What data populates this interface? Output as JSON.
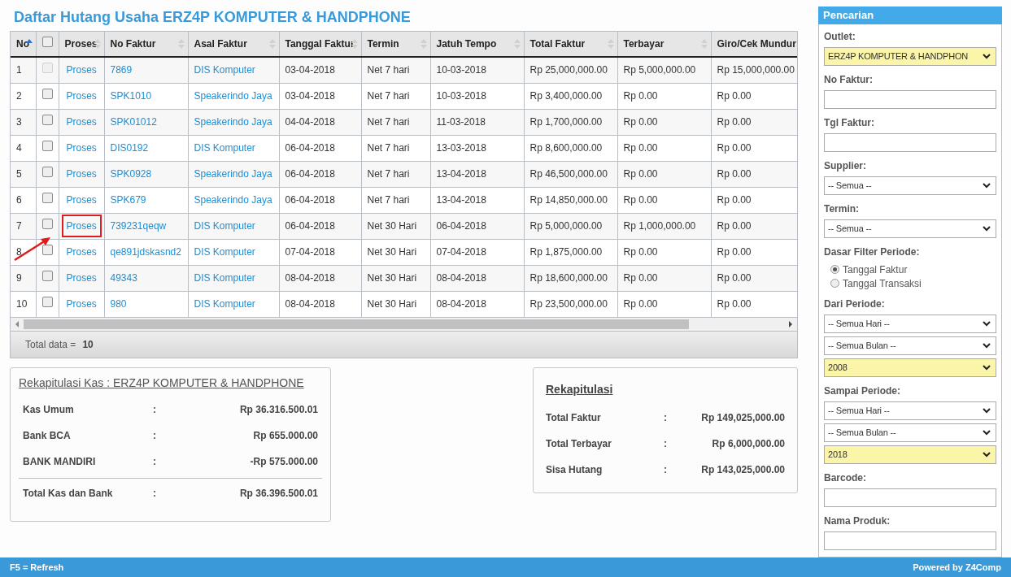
{
  "title": "Daftar Hutang Usaha ERZ4P KOMPUTER & HANDPHONE",
  "table": {
    "columns": [
      {
        "label": "No",
        "kind": "text",
        "sortable": true,
        "sorted": true
      },
      {
        "kind": "checkbox",
        "checked": false,
        "sortable": false
      },
      {
        "label": "Proses",
        "kind": "text",
        "sortable": true,
        "sorted": false
      },
      {
        "label": "No Faktur",
        "kind": "text",
        "sortable": true,
        "sorted": false
      },
      {
        "label": "Asal Faktur",
        "kind": "text",
        "sortable": true,
        "sorted": false
      },
      {
        "label": "Tanggal Faktur",
        "kind": "text",
        "sortable": true,
        "sorted": false
      },
      {
        "label": "Termin",
        "kind": "text",
        "sortable": true,
        "sorted": false
      },
      {
        "label": "Jatuh Tempo",
        "kind": "text",
        "sortable": true,
        "sorted": false
      },
      {
        "label": "Total Faktur",
        "kind": "text",
        "sortable": true,
        "sorted": false
      },
      {
        "label": "Terbayar",
        "kind": "text",
        "sortable": true,
        "sorted": false
      },
      {
        "label": "Giro/Cek Mundur",
        "kind": "text",
        "sortable": false
      }
    ],
    "rows": [
      {
        "no": "1",
        "checked": false,
        "disabled": true,
        "proses": "Proses",
        "highlighted": false,
        "no_faktur": "7869",
        "asal_faktur": "DIS Komputer",
        "tanggal_faktur": "03-04-2018",
        "termin": "Net 7 hari",
        "jatuh_tempo": "10-03-2018",
        "total_faktur": "Rp 25,000,000.00",
        "terbayar": "Rp 5,000,000.00",
        "giro": "Rp 15,000,000.00"
      },
      {
        "no": "2",
        "checked": false,
        "disabled": false,
        "proses": "Proses",
        "highlighted": false,
        "no_faktur": "SPK1010",
        "asal_faktur": "Speakerindo Jaya",
        "tanggal_faktur": "03-04-2018",
        "termin": "Net 7 hari",
        "jatuh_tempo": "10-03-2018",
        "total_faktur": "Rp 3,400,000.00",
        "terbayar": "Rp 0.00",
        "giro": "Rp 0.00"
      },
      {
        "no": "3",
        "checked": false,
        "disabled": false,
        "proses": "Proses",
        "highlighted": false,
        "no_faktur": "SPK01012",
        "asal_faktur": "Speakerindo Jaya",
        "tanggal_faktur": "04-04-2018",
        "termin": "Net 7 hari",
        "jatuh_tempo": "11-03-2018",
        "total_faktur": "Rp 1,700,000.00",
        "terbayar": "Rp 0.00",
        "giro": "Rp 0.00"
      },
      {
        "no": "4",
        "checked": false,
        "disabled": false,
        "proses": "Proses",
        "highlighted": false,
        "no_faktur": "DIS0192",
        "asal_faktur": "DIS Komputer",
        "tanggal_faktur": "06-04-2018",
        "termin": "Net 7 hari",
        "jatuh_tempo": "13-03-2018",
        "total_faktur": "Rp 8,600,000.00",
        "terbayar": "Rp 0.00",
        "giro": "Rp 0.00"
      },
      {
        "no": "5",
        "checked": false,
        "disabled": false,
        "proses": "Proses",
        "highlighted": false,
        "no_faktur": "SPK0928",
        "asal_faktur": "Speakerindo Jaya",
        "tanggal_faktur": "06-04-2018",
        "termin": "Net 7 hari",
        "jatuh_tempo": "13-04-2018",
        "total_faktur": "Rp 46,500,000.00",
        "terbayar": "Rp 0.00",
        "giro": "Rp 0.00"
      },
      {
        "no": "6",
        "checked": false,
        "disabled": false,
        "proses": "Proses",
        "highlighted": false,
        "no_faktur": "SPK679",
        "asal_faktur": "Speakerindo Jaya",
        "tanggal_faktur": "06-04-2018",
        "termin": "Net 7 hari",
        "jatuh_tempo": "13-04-2018",
        "total_faktur": "Rp 14,850,000.00",
        "terbayar": "Rp 0.00",
        "giro": "Rp 0.00"
      },
      {
        "no": "7",
        "checked": false,
        "disabled": false,
        "proses": "Proses",
        "highlighted": true,
        "no_faktur": "739231qeqw",
        "asal_faktur": "DIS Komputer",
        "tanggal_faktur": "06-04-2018",
        "termin": "Net 30 Hari",
        "jatuh_tempo": "06-04-2018",
        "total_faktur": "Rp 5,000,000.00",
        "terbayar": "Rp 1,000,000.00",
        "giro": "Rp 0.00"
      },
      {
        "no": "8",
        "checked": false,
        "disabled": false,
        "proses": "Proses",
        "highlighted": false,
        "no_faktur": "qe891jdskasnd2",
        "asal_faktur": "DIS Komputer",
        "tanggal_faktur": "07-04-2018",
        "termin": "Net 30 Hari",
        "jatuh_tempo": "07-04-2018",
        "total_faktur": "Rp 1,875,000.00",
        "terbayar": "Rp 0.00",
        "giro": "Rp 0.00"
      },
      {
        "no": "9",
        "checked": false,
        "disabled": false,
        "proses": "Proses",
        "highlighted": false,
        "no_faktur": "49343",
        "asal_faktur": "DIS Komputer",
        "tanggal_faktur": "08-04-2018",
        "termin": "Net 30 Hari",
        "jatuh_tempo": "08-04-2018",
        "total_faktur": "Rp 18,600,000.00",
        "terbayar": "Rp 0.00",
        "giro": "Rp 0.00"
      },
      {
        "no": "10",
        "checked": false,
        "disabled": false,
        "proses": "Proses",
        "highlighted": false,
        "no_faktur": "980",
        "asal_faktur": "DIS Komputer",
        "tanggal_faktur": "08-04-2018",
        "termin": "Net 30 Hari",
        "jatuh_tempo": "08-04-2018",
        "total_faktur": "Rp 23,500,000.00",
        "terbayar": "Rp 0.00",
        "giro": "Rp 0.00"
      }
    ],
    "footer_label": "Total data =",
    "footer_value": "10"
  },
  "kas": {
    "title": "Rekapitulasi Kas : ERZ4P KOMPUTER & HANDPHONE",
    "items": [
      {
        "label": "Kas Umum",
        "sep": ":",
        "value": "Rp 36.316.500.01"
      },
      {
        "label": "Bank BCA",
        "sep": ":",
        "value": "Rp 655.000.00"
      },
      {
        "label": "BANK MANDIRI",
        "sep": ":",
        "value": "-Rp 575.000.00"
      }
    ],
    "total": {
      "label": "Total Kas dan Bank",
      "sep": ":",
      "value": "Rp 36.396.500.01"
    }
  },
  "rekap": {
    "title": "Rekapitulasi",
    "items": [
      {
        "label": "Total Faktur",
        "sep": ":",
        "value": "Rp 149,025,000.00"
      },
      {
        "label": "Total Terbayar",
        "sep": ":",
        "value": "Rp 6,000,000.00"
      },
      {
        "label": "Sisa Hutang",
        "sep": ":",
        "value": "Rp 143,025,000.00"
      }
    ]
  },
  "sidebar": {
    "title": "Pencarian",
    "fields": [
      {
        "label": "Outlet:",
        "controls": [
          {
            "kind": "select",
            "value": "ERZ4P KOMPUTER & HANDPHON",
            "highlighted": true
          }
        ]
      },
      {
        "label": "No Faktur:",
        "controls": [
          {
            "kind": "text"
          }
        ]
      },
      {
        "label": "Tgl Faktur:",
        "controls": [
          {
            "kind": "text"
          }
        ]
      },
      {
        "label": "Supplier:",
        "controls": [
          {
            "kind": "select",
            "value": "-- Semua --",
            "highlighted": false
          }
        ]
      },
      {
        "label": "Termin:",
        "controls": [
          {
            "kind": "select",
            "value": "-- Semua --",
            "highlighted": false
          }
        ]
      },
      {
        "label": "Dasar Filter Periode:",
        "controls": [
          {
            "kind": "radio",
            "options": [
              {
                "label": "Tanggal Faktur",
                "selected": true
              },
              {
                "label": "Tanggal Transaksi",
                "selected": false
              }
            ]
          }
        ]
      },
      {
        "label": "Dari Periode:",
        "controls": [
          {
            "kind": "select",
            "value": "-- Semua Hari --",
            "highlighted": false
          },
          {
            "kind": "select",
            "value": "-- Semua Bulan --",
            "highlighted": false
          },
          {
            "kind": "select",
            "value": "2008",
            "highlighted": true
          }
        ]
      },
      {
        "label": "Sampai Periode:",
        "controls": [
          {
            "kind": "select",
            "value": "-- Semua Hari --",
            "highlighted": false
          },
          {
            "kind": "select",
            "value": "-- Semua Bulan --",
            "highlighted": false
          },
          {
            "kind": "select",
            "value": "2018",
            "highlighted": true
          }
        ]
      },
      {
        "label": "Barcode:",
        "controls": [
          {
            "kind": "text"
          }
        ]
      },
      {
        "label": "Nama Produk:",
        "controls": [
          {
            "kind": "text"
          }
        ]
      }
    ]
  },
  "status_bar": {
    "left": "F5 = Refresh",
    "right": "Powered by Z4Comp"
  }
}
